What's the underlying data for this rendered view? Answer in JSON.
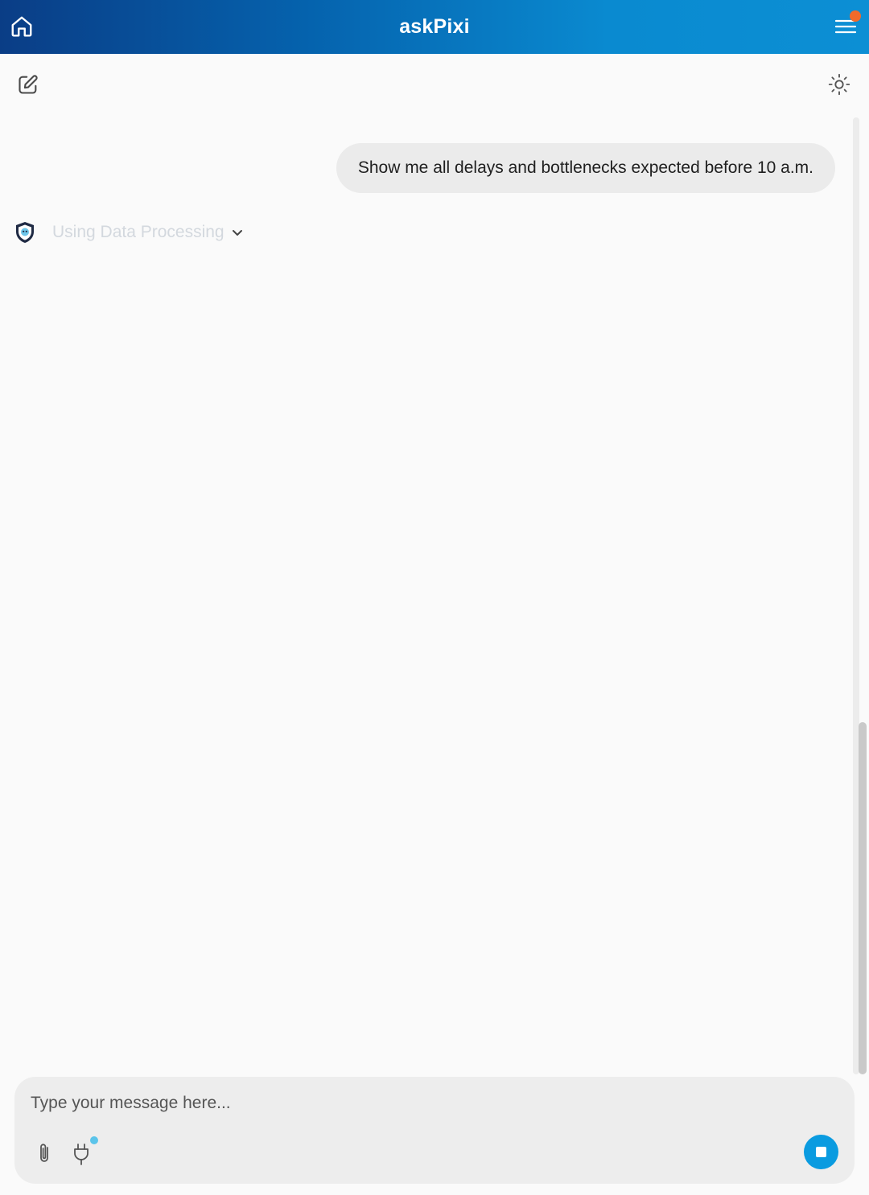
{
  "header": {
    "title": "askPixi",
    "home_icon": "home-icon",
    "menu_icon": "hamburger-menu-icon",
    "notification_color": "#f26a2a"
  },
  "toolbar": {
    "new_chat_icon": "edit-icon",
    "theme_icon": "sun-icon"
  },
  "conversation": {
    "user_message": "Show me all delays and bottlenecks expected before 10 a.m.",
    "assistant_status": "Using Data Processing",
    "assistant_avatar_icon": "pixi-shield-icon"
  },
  "composer": {
    "placeholder": "Type your message here...",
    "value": "",
    "attach_icon": "paperclip-icon",
    "plugin_icon": "plug-icon",
    "stop_icon": "stop-icon",
    "accent_color": "#0a9be0"
  }
}
